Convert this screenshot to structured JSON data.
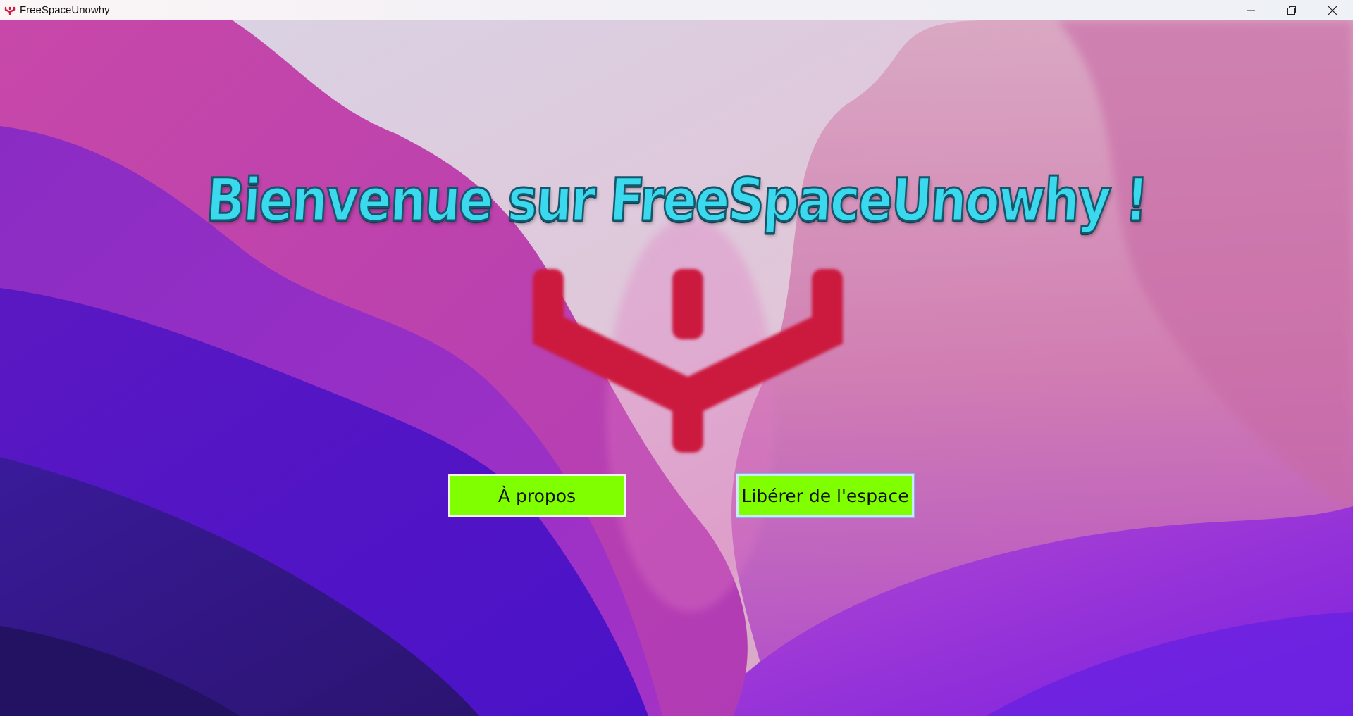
{
  "window": {
    "title": "FreeSpaceUnowhy",
    "controls": [
      "minimize-icon",
      "restore-icon",
      "close-icon"
    ]
  },
  "main": {
    "heading": "Bienvenue sur FreeSpaceUnowhy !",
    "logo": "unowhy-logo",
    "buttons": {
      "about_label": "À propos",
      "free_space_label": "Libérer de l'espace"
    }
  },
  "colors": {
    "heading_fill": "#3ad9ee",
    "heading_outline": "#17566a",
    "logo": "#cc1a3f",
    "button_bg": "#7fff00"
  }
}
